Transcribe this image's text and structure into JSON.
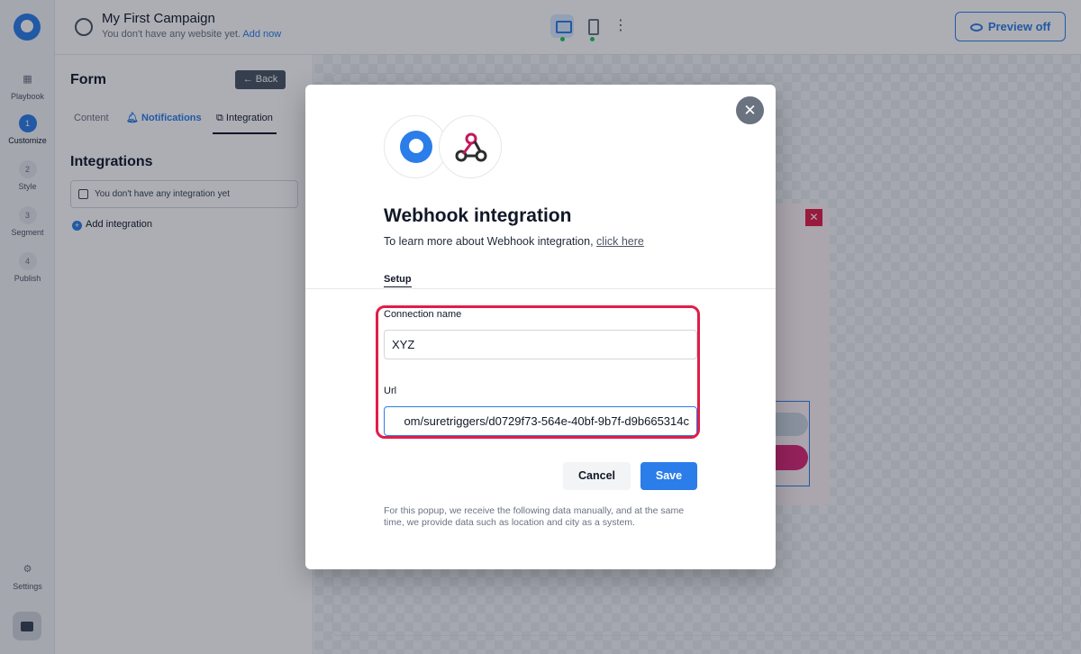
{
  "header": {
    "campaign_title": "My First Campaign",
    "campaign_subtitle": "You don't have any website yet.",
    "add_now_label": "Add now",
    "preview_label": "Preview off"
  },
  "rail": {
    "items": [
      {
        "label": "Playbook"
      },
      {
        "label": "Customize",
        "step": "1"
      },
      {
        "label": "Style",
        "step": "2"
      },
      {
        "label": "Segment",
        "step": "3"
      },
      {
        "label": "Publish",
        "step": "4"
      }
    ],
    "settings_label": "Settings"
  },
  "panel": {
    "title": "Form",
    "back_label": "Back",
    "tabs": [
      {
        "label": "Content"
      },
      {
        "label": "Notifications"
      },
      {
        "label": "Integration"
      }
    ],
    "integrations_title": "Integrations",
    "empty_text": "You don't have any integration yet",
    "add_integration_label": "Add integration"
  },
  "modal": {
    "title": "Webhook integration",
    "subtitle": "To learn more about Webhook integration,",
    "link_label": "click here",
    "setup_tab": "Setup",
    "connection_label": "Connection name",
    "connection_value": "XYZ",
    "url_label": "Url",
    "url_value": "om/suretriggers/d0729f73-564e-40bf-9b7f-d9b665314c",
    "cancel_label": "Cancel",
    "save_label": "Save",
    "note": "For this popup, we receive the following data manually, and at the same time, we provide data such as location and city as a system.",
    "close_glyph": "✕"
  },
  "colors": {
    "accent": "#2b7de9",
    "highlight": "#e11d48"
  }
}
